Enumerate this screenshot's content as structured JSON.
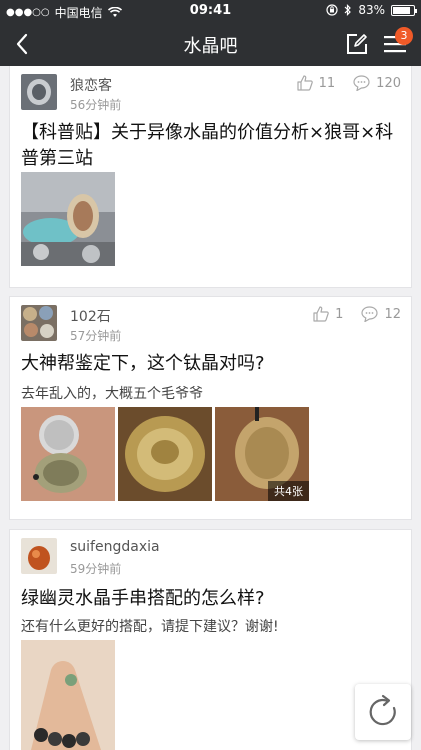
{
  "status_bar": {
    "carrier": "中国电信",
    "time": "09:41",
    "battery": "83%",
    "battery_level": 0.83
  },
  "nav": {
    "title": "水晶吧",
    "badge": "3"
  },
  "posts": [
    {
      "author": "狼恋客",
      "time": "56分钟前",
      "likes": "11",
      "comments": "120",
      "title": "【科普贴】关于异像水晶的价值分析×狼哥×科普第三站"
    },
    {
      "author": "102石",
      "time": "57分钟前",
      "likes": "1",
      "comments": "12",
      "title": "大神帮鉴定下，这个钛晶对吗?",
      "excerpt": "去年乱入的，大概五个毛爷爷",
      "image_count": "共4张"
    },
    {
      "author": "suifengdaxia",
      "time": "59分钟前",
      "title": "绿幽灵水晶手串搭配的怎么样?",
      "excerpt": "还有什么更好的搭配，请提下建议？谢谢!"
    }
  ],
  "icons": {
    "back": "chevron-left-icon",
    "compose": "compose-icon",
    "menu": "menu-icon",
    "like": "thumbs-up-icon",
    "comment": "comment-icon",
    "refresh": "refresh-icon"
  }
}
